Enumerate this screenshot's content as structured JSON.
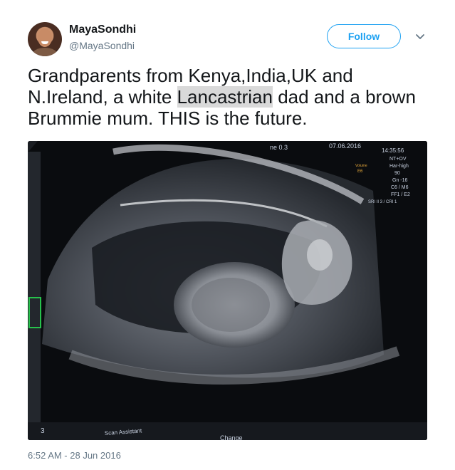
{
  "author": {
    "display_name": "MayaSondhi",
    "handle": "@MayaSondhi"
  },
  "actions": {
    "follow_label": "Follow",
    "more_icon": "chevron-down-icon"
  },
  "tweet": {
    "text_before": "Grandparents from Kenya,India,UK and N.Ireland, a white ",
    "highlighted": "Lancastrian",
    "text_after": " dad and a brown Brummie mum. THIS is the future.",
    "timestamp": "6:52 AM - 28 Jun 2016"
  },
  "media": {
    "kind": "ultrasound-photo",
    "screen_text": {
      "date": "07.06.2016",
      "time": "14:35:56",
      "top_readout": "ne 0.3",
      "settings": [
        "NT+OV",
        "Har-high",
        "90",
        "Gn -16",
        "C6 / M6",
        "FF1 / E2",
        "SRI II 3 / CRI 1"
      ],
      "left_values": [
        "Volume",
        "E6"
      ],
      "number": "3",
      "scan_assistant": "Scan Assistant",
      "change": "Change"
    }
  },
  "colors": {
    "accent": "#1da1f2",
    "name": "#14171a",
    "secondary": "#657786",
    "highlight": "#d9d9d9"
  }
}
